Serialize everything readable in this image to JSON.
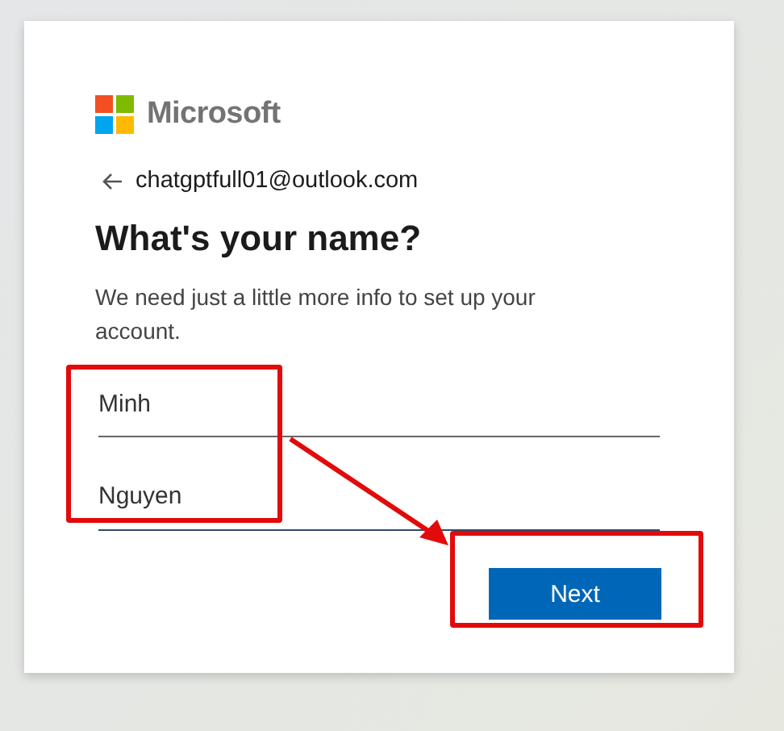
{
  "logo": {
    "text": "Microsoft"
  },
  "account": {
    "email": "chatgptfull01@outlook.com"
  },
  "title": "What's your name?",
  "description": "We need just a little more info to set up your account.",
  "fields": [
    {
      "value": "Minh",
      "focused": false
    },
    {
      "value": "Nguyen",
      "focused": true
    }
  ],
  "buttons": [
    {
      "label": "Next"
    }
  ],
  "annotations": [
    {
      "kind": "box"
    },
    {
      "kind": "arrow"
    },
    {
      "kind": "box"
    }
  ]
}
